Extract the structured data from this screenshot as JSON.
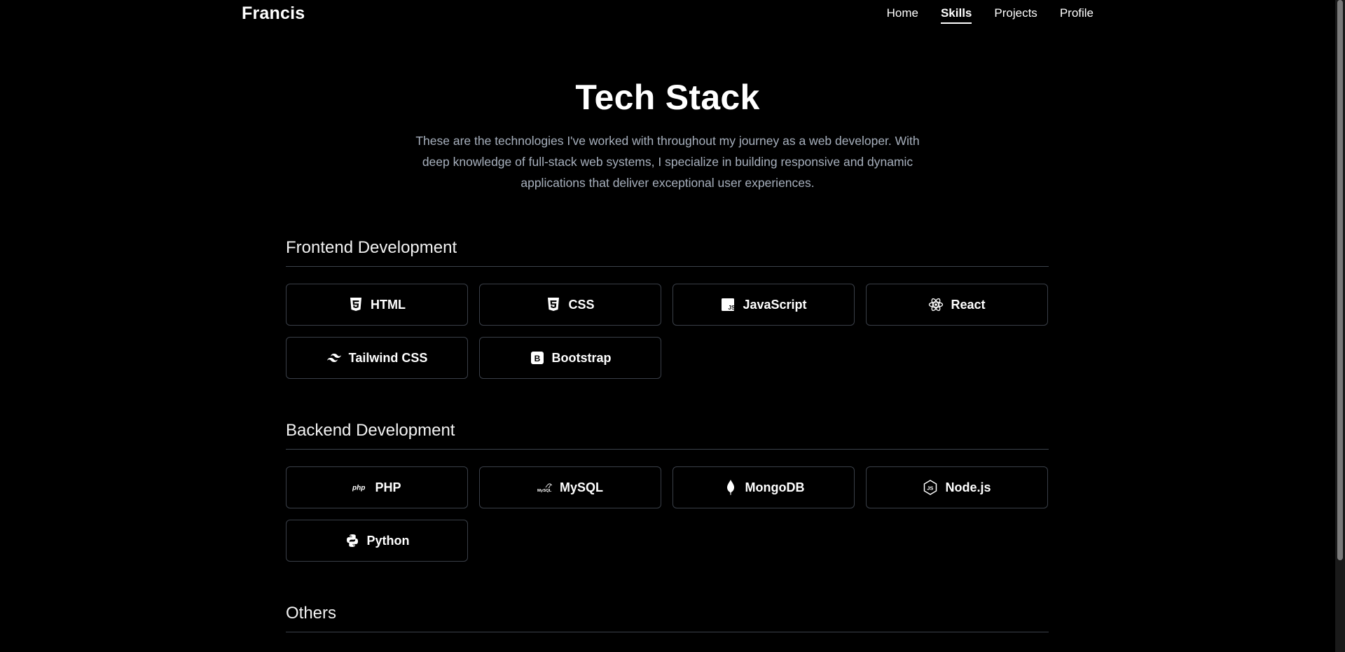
{
  "nav": {
    "brand": "Francis",
    "links": [
      {
        "label": "Home"
      },
      {
        "label": "Skills"
      },
      {
        "label": "Projects"
      },
      {
        "label": "Profile"
      }
    ],
    "active": "Skills"
  },
  "hero": {
    "title": "Tech Stack",
    "description": "These are the technologies I've worked with throughout my journey as a web developer. With deep knowledge of full-stack web systems, I specialize in building responsive and dynamic applications that deliver exceptional user experiences."
  },
  "sections": [
    {
      "title": "Frontend Development",
      "items": [
        {
          "label": "HTML",
          "icon": "html5-icon"
        },
        {
          "label": "CSS",
          "icon": "css3-icon"
        },
        {
          "label": "JavaScript",
          "icon": "javascript-icon"
        },
        {
          "label": "React",
          "icon": "react-icon"
        },
        {
          "label": "Tailwind CSS",
          "icon": "tailwind-icon"
        },
        {
          "label": "Bootstrap",
          "icon": "bootstrap-icon"
        }
      ]
    },
    {
      "title": "Backend Development",
      "items": [
        {
          "label": "PHP",
          "icon": "php-icon"
        },
        {
          "label": "MySQL",
          "icon": "mysql-icon"
        },
        {
          "label": "MongoDB",
          "icon": "mongodb-icon"
        },
        {
          "label": "Node.js",
          "icon": "nodejs-icon"
        },
        {
          "label": "Python",
          "icon": "python-icon"
        }
      ]
    },
    {
      "title": "Others",
      "items": []
    }
  ],
  "colors": {
    "background": "#000000",
    "text": "#ffffff",
    "muted": "#a7b0bd",
    "border": "#3a3f48"
  }
}
